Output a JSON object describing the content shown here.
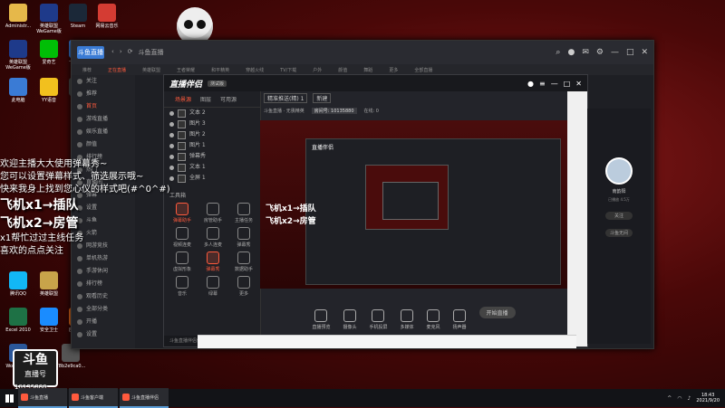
{
  "desktop": {
    "icons": [
      {
        "label": "Administr...",
        "color": "#e6b84a"
      },
      {
        "label": "英雄联盟WeGame版",
        "color": "#1e3a8a"
      },
      {
        "label": "Steam",
        "color": "#1b2838"
      },
      {
        "label": "网易云音乐",
        "color": "#d43c33"
      },
      {
        "label": "英雄联盟WeGame版",
        "color": "#1e3a8a"
      },
      {
        "label": "爱奇艺",
        "color": "#00be06"
      },
      {
        "label": "一键直播",
        "color": "#3a7bd5"
      },
      {
        "label": "此电脑",
        "color": "#3a7bd5"
      },
      {
        "label": "YY语音",
        "color": "#f2c01e"
      },
      {
        "label": "应用",
        "color": "#4a4a4a"
      },
      {
        "label": "腾讯QQ",
        "color": "#12b7f5"
      },
      {
        "label": "英雄联盟",
        "color": "#c8a44a"
      },
      {
        "label": "Excel 2010",
        "color": "#1e7145"
      },
      {
        "label": "安全卫士",
        "color": "#1a8cff"
      },
      {
        "label": "应用中心",
        "color": "#e86a1a"
      },
      {
        "label": "Word 2010",
        "color": "#2b579a"
      },
      {
        "label": "78b2e9ca0...",
        "color": "#555"
      }
    ]
  },
  "overlay": {
    "lines": [
      "欢迎主播大大使用弹幕秀~",
      "您可以设置弹幕样式、筛选展示哦~",
      "快来我身上找到您心仪的样式吧(#^0^#)"
    ],
    "big1": "飞机x1→插队",
    "big2": "飞机x2→房管",
    "extra1": "x1帮忙过过主线任务",
    "extra2": "喜欢的点点关注"
  },
  "brand": {
    "top": "斗鱼",
    "bottom": "直播号",
    "room_id": "10135880"
  },
  "main_window": {
    "title": "斗鱼直播",
    "nav": [
      "关注",
      "推荐",
      "分类"
    ],
    "categories": [
      "推荐",
      "正在直播",
      "英雄联盟",
      "王者荣耀",
      "和平精英",
      "穿越火线",
      "TV/下载",
      "户外",
      "颜值",
      "舞蹈",
      "更多",
      "全部直播"
    ],
    "active_category": "正在直播",
    "sidebar": [
      "关注",
      "推荐",
      "首页",
      "游戏直播",
      "娱乐直播",
      "颜值",
      "排行榜",
      "热门",
      "直播间",
      "弹幕",
      "设置",
      "斗鱼",
      "火箭",
      "网游竞技",
      "单机热游",
      "手游休闲",
      "排行榜",
      "观看历史",
      "全部分类",
      "开播",
      "设置"
    ]
  },
  "companion": {
    "brand": "直播伴侣",
    "tag": "测试版",
    "tabs": [
      "场景源",
      "图层",
      "可用源"
    ],
    "active_tab": "场景源",
    "scenes": [
      "文本 2",
      "图片 3",
      "图片 2",
      "图片 1",
      "弹幕秀",
      "文本 1",
      "全屏 1"
    ],
    "tools_label": "工具箱",
    "tools": [
      {
        "label": "弹幕助手",
        "red": true
      },
      {
        "label": "房管助手",
        "red": false
      },
      {
        "label": "主播任务",
        "red": false
      },
      {
        "label": "视频连麦",
        "red": false
      },
      {
        "label": "多人连麦",
        "red": false
      },
      {
        "label": "弹幕秀",
        "red": false
      },
      {
        "label": "虚拟形象",
        "red": false
      },
      {
        "label": "弹幕秀",
        "red": true
      },
      {
        "label": "数据助手",
        "red": false
      },
      {
        "label": "音乐",
        "red": false
      },
      {
        "label": "绿幕",
        "red": false
      },
      {
        "label": "更多",
        "red": false
      }
    ],
    "footer": "斗鱼直播伴侣使用帮助",
    "head_title": "精准推送(精) 1",
    "head_btn": "新建",
    "info": [
      "斗鱼直播 · 无畏精英",
      "房间号: 10135880",
      "在线: 0"
    ],
    "preview_title": "直播伴侣",
    "preview_big1": "飞机x1→插队",
    "preview_big2": "飞机x2→房管",
    "bar": [
      "直播预览",
      "摄像头",
      "手机投屏",
      "多媒体",
      "麦克风",
      "扬声器"
    ],
    "start_label": "开始直播"
  },
  "profile": {
    "name": "南韵阳",
    "sub": "已播放 4.5万",
    "btn1": "关注",
    "btn2": "斗鱼无间"
  },
  "taskbar": {
    "tasks": [
      "斗鱼直播",
      "斗鱼客户端",
      "斗鱼直播伴侣"
    ],
    "time": "18:43",
    "date": "2021/9/20"
  }
}
